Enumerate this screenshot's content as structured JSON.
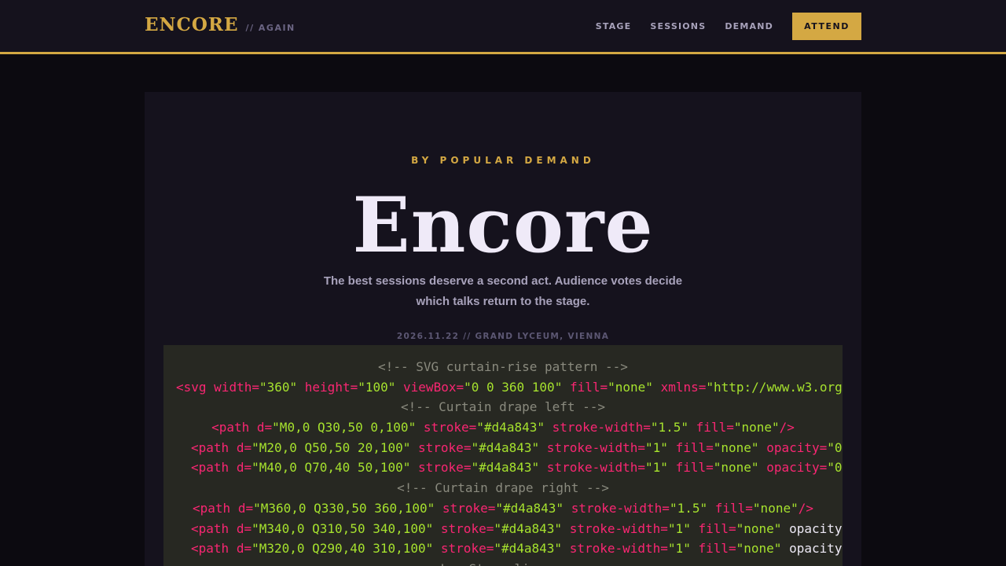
{
  "header": {
    "logo": "ENCORE",
    "tagline": "// AGAIN",
    "nav": [
      "STAGE",
      "SESSIONS",
      "DEMAND"
    ],
    "cta": "ATTEND"
  },
  "hero": {
    "kicker": "BY POPULAR DEMAND",
    "title": "Encore",
    "subtitle": "The best sessions deserve a second act. Audience votes decide which talks return to the stage.",
    "meta": "2026.11.22 // GRAND LYCEUM, VIENNA"
  },
  "code": {
    "lines": [
      "<!-- SVG curtain-rise pattern -->",
      "<svg width=\"360\" height=\"100\" viewBox=\"0 0 360 100\" fill=\"none\" xmlns=\"http://www.w3.org",
      "<!-- Curtain drape left -->",
      "<path d=\"M0,0 Q30,50 0,100\" stroke=\"#d4a843\" stroke-width=\"1.5\" fill=\"none\"/>",
      "<path d=\"M20,0 Q50,50 20,100\" stroke=\"#d4a843\" stroke-width=\"1\" fill=\"none\" opacity=\"0",
      "<path d=\"M40,0 Q70,40 50,100\" stroke=\"#d4a843\" stroke-width=\"1\" fill=\"none\" opacity=\"0",
      "<!-- Curtain drape right -->",
      "<path d=\"M360,0 Q330,50 360,100\" stroke=\"#d4a843\" stroke-width=\"1.5\" fill=\"none\"/>",
      "<path d=\"M340,0 Q310,50 340,100\" stroke=\"#d4a843\" stroke-width=\"1\" fill=\"none\" opacity",
      "<path d=\"M320,0 Q290,40 310,100\" stroke=\"#d4a843\" stroke-width=\"1\" fill=\"none\" opacity",
      "<!-- Stage line -->"
    ]
  },
  "colors": {
    "accent": "#d4a843",
    "background": "#0c0a10",
    "surface": "#15121d",
    "code_bg": "#272822"
  }
}
